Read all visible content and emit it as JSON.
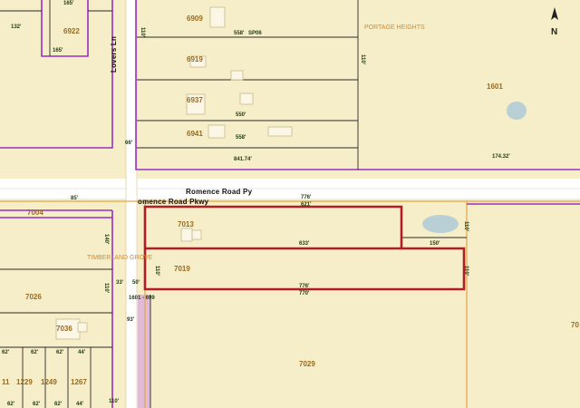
{
  "compass": {
    "label": "N"
  },
  "roads": {
    "romence_upper": "Romence Road Py",
    "romence_lower": "omence Road Pkwy",
    "lovers_lane": "Lovers Ln"
  },
  "subdivisions": {
    "portage_heights": "PORTAGE HEIGHTS",
    "timberland_grove": "TIMBERLAND GROVE"
  },
  "parcels": {
    "p6909": "6909",
    "p6919": "6919",
    "p6937": "6937",
    "p6941": "6941",
    "p6922": "6922",
    "p1601": "1601",
    "p7013": "7013",
    "p7019": "7019",
    "p7026": "7026",
    "p7036": "7036",
    "p7029": "7029",
    "p7004": "7004",
    "p7_right": "70",
    "p1229": "1229",
    "p1249": "1249",
    "p1267": "1267",
    "p11": "11"
  },
  "dimensions": {
    "d132": "132'",
    "d165a": "165'",
    "d165b": "165'",
    "d558_1": "558'",
    "sp06": "SP06",
    "d550": "550'",
    "d558_2": "558'",
    "d841": "841.74'",
    "d174": "174.32'",
    "d66": "66'",
    "d85": "85'",
    "d776_1": "776'",
    "d621": "621'",
    "d633": "633'",
    "d150": "150'",
    "d776_2": "776'",
    "d770": "770'",
    "d33": "33'",
    "d50": "50'",
    "d93": "93'",
    "d110": "110'",
    "d62a": "62'",
    "d62b": "62'",
    "d62c": "62'",
    "d62d": "62'",
    "d62e": "62'",
    "d62f": "62'",
    "d62g": "62'",
    "d44a": "44'",
    "d44b": "44'",
    "d140": "140'",
    "d110b": "110'",
    "d1601_plat": "1601 - 699"
  },
  "colors": {
    "background": "#f6eec8",
    "parcel_line": "#2a2a2a",
    "subdivision_line": "#9a2fc0",
    "highlight": "#b41c24",
    "road_fill": "#ffffff",
    "road_edge": "#e3a64a",
    "building": "#fbf6e6",
    "water": "#b9cfd6"
  }
}
